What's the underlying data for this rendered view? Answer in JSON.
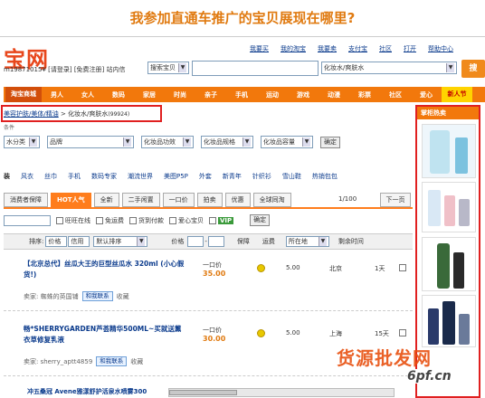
{
  "headline": "我参加直通车推广的宝贝展现在哪里?",
  "logo": "宝网",
  "top_links": [
    "我要买",
    "我的淘宝",
    "我要卖",
    "支付宝",
    "社区",
    "打开",
    "帮助中心"
  ],
  "user_info": "m19871015¥ [请登录] [免费注册] 站内信",
  "search": {
    "type": "搜索宝贝",
    "value": "",
    "category": "化妆水/爽肤水",
    "button": "搜"
  },
  "nav": [
    "淘宝商城",
    "男人",
    "女人",
    "数码",
    "家居",
    "时尚",
    "亲子",
    "手机",
    "运动",
    "游戏",
    "动漫",
    "彩票",
    "社区",
    "爱心",
    "新人节"
  ],
  "breadcrumb": {
    "parent": "美容护肤/美体/精油",
    "sep": ">",
    "current": "化妆水/爽肤水",
    "count": "(99924)"
  },
  "note": "条件",
  "filters": {
    "f1": "水分类",
    "f2": "品牌",
    "f3": "化妆品功效",
    "f4": "化妆品规格",
    "f5": "化妆品容量",
    "ok": "确定"
  },
  "category_row": [
    "装",
    "风衣",
    "丝巾",
    "手机",
    "数码专家",
    "潮流世界",
    "美图P5P",
    "外套",
    "新青年",
    "针织衫",
    "雪山鞋",
    "热销包包"
  ],
  "tabs": [
    "消费者保障",
    "HOT人气",
    "全新",
    "二手闲置",
    "一口价",
    "拍卖",
    "优惠",
    "全球同淘"
  ],
  "page_info": "1/100",
  "next": "下一页",
  "checks": {
    "a": "旺旺在线",
    "b": "免运费",
    "c": "货到付款",
    "d": "爱心宝贝",
    "vip": "VIP",
    "ok": "确定"
  },
  "sortbar": {
    "sort": "排序:",
    "s1": "价格",
    "s2": "信用",
    "s3": "默认排序",
    "price": "价格",
    "dash": "-",
    "protect": "保障",
    "fee": "运费",
    "loc": "所在地",
    "time": "剩余时间"
  },
  "rows": [
    {
      "title": "【北京总代】丝瓜大王的巨型丝瓜水 320ml (小心假货!)",
      "seller": "卖家: 蜘蛛的英国铺",
      "ww": "和我联系",
      "fav": "收藏",
      "price_label": "一口价",
      "price": "35.00",
      "fee": "5.00",
      "loc": "北京",
      "days": "1天"
    },
    {
      "title": "畅*SHERRYGARDEN芦荟精华500ML~买就送薰衣草修复乳液",
      "seller": "卖家: sherry_aptt4859",
      "ww": "和我联系",
      "fav": "收藏",
      "price_label": "一口价",
      "price": "30.00",
      "fee": "5.00",
      "loc": "上海",
      "days": "15天"
    }
  ],
  "last_row": "冲五桑冠 Avene雅漾舒护活泉水喷雾300",
  "side": {
    "head": "掌柜热卖"
  },
  "watermark": "货源批发网",
  "watermark2": "6pf.cn"
}
